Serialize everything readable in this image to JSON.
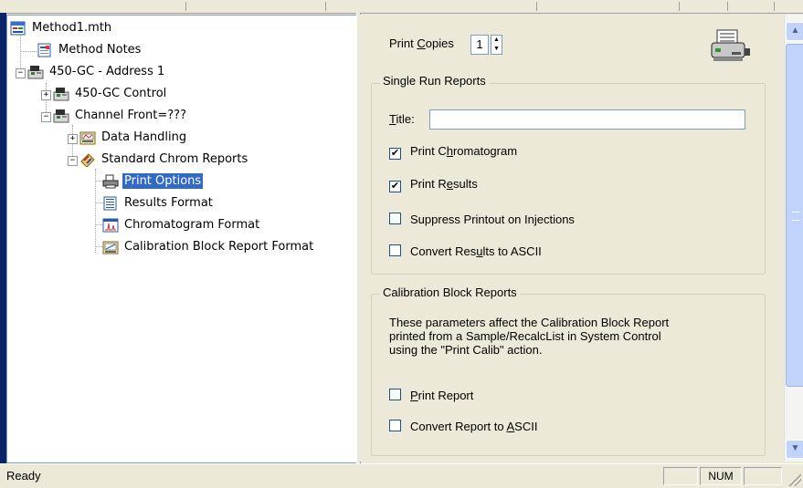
{
  "tree": {
    "nodes": [
      {
        "label": "Method1.mth",
        "icon": "method-file-icon"
      },
      {
        "label": "Method Notes",
        "icon": "notes-icon"
      },
      {
        "label": "450-GC - Address 1",
        "icon": "gc-instrument-icon"
      },
      {
        "label": "450-GC Control",
        "icon": "gc-instrument-icon"
      },
      {
        "label": "Channel Front=???",
        "icon": "gc-instrument-icon"
      },
      {
        "label": "Data Handling",
        "icon": "data-handling-icon"
      },
      {
        "label": "Standard Chrom Reports",
        "icon": "reports-icon"
      },
      {
        "label": "Print Options",
        "icon": "printer-icon",
        "selected": true
      },
      {
        "label": "Results Format",
        "icon": "results-format-icon"
      },
      {
        "label": "Chromatogram Format",
        "icon": "chromatogram-icon"
      },
      {
        "label": "Calibration Block Report Format",
        "icon": "calibration-icon"
      }
    ]
  },
  "print_options": {
    "copies_label_pre": "Print ",
    "copies_label_ul": "C",
    "copies_label_post": "opies",
    "copies_value": "1",
    "single_run": {
      "title": "Single Run Reports",
      "title_label_ul": "T",
      "title_label_post": "itle:",
      "title_value": "",
      "print_chromatogram": {
        "pre": "Print C",
        "ul": "h",
        "post": "romatogram",
        "checked": true
      },
      "print_results": {
        "pre": "Print R",
        "ul": "e",
        "post": "sults",
        "checked": true
      },
      "suppress_printout": {
        "pre": "Suppress Printout on Injections",
        "ul": "",
        "post": "",
        "checked": false
      },
      "convert_ascii": {
        "pre": "Convert Res",
        "ul": "u",
        "post": "lts to ASCII",
        "checked": false
      }
    },
    "calibration": {
      "title": "Calibration Block Reports",
      "description": "These parameters affect the Calibration Block Report printed from a Sample/RecalcList in System Control using the \"Print Calib\" action.",
      "print_report": {
        "pre": "",
        "ul": "P",
        "post": "rint Report",
        "checked": false
      },
      "convert_report": {
        "pre": "Convert Report to ",
        "ul": "A",
        "post": "SCII",
        "checked": false
      }
    }
  },
  "statusbar": {
    "text": "Ready",
    "num": "NUM"
  },
  "colors": {
    "selection": "#316ac5",
    "window_bg": "#ece9d8"
  }
}
